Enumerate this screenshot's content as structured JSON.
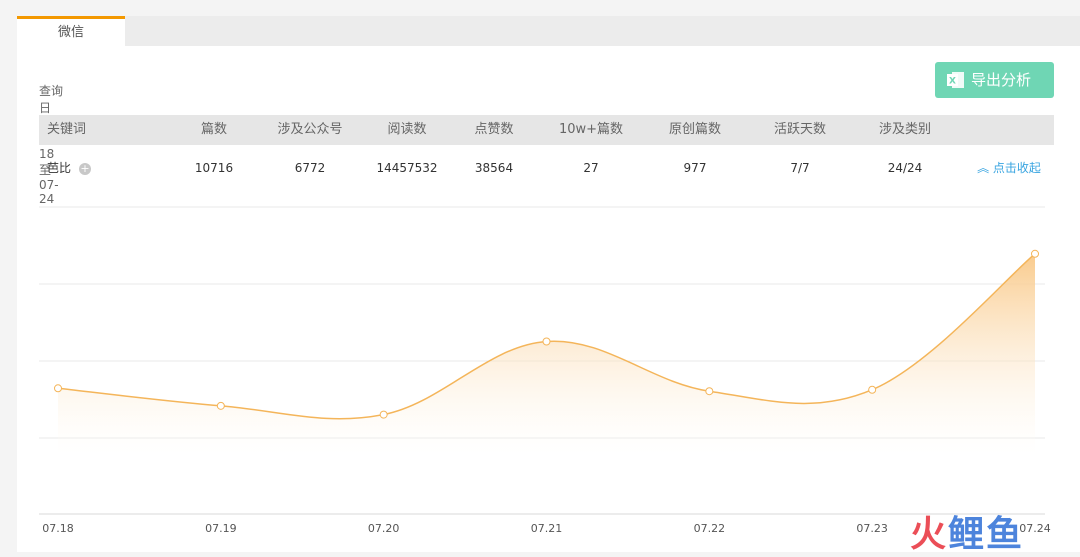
{
  "tab": {
    "label": "微信"
  },
  "query": {
    "text": "查询日期：07-18 至 07-24"
  },
  "export": {
    "label": "导出分析"
  },
  "table": {
    "headers": [
      "关键词",
      "篇数",
      "涉及公众号",
      "阅读数",
      "点赞数",
      "10w+篇数",
      "原创篇数",
      "活跃天数",
      "涉及类别"
    ],
    "row": {
      "keyword": "芭比",
      "cells": [
        "10716",
        "6772",
        "14457532",
        "38564",
        "27",
        "977",
        "7/7",
        "24/24"
      ],
      "collapse_label": "点击收起"
    }
  },
  "chart_data": {
    "type": "area",
    "categories": [
      "07.18",
      "07.19",
      "07.20",
      "07.21",
      "07.22",
      "07.23",
      "07.24"
    ],
    "values": [
      0.43,
      0.37,
      0.34,
      0.59,
      0.42,
      0.425,
      0.89
    ],
    "ylim": [
      0,
      1.05
    ],
    "grid": true,
    "colors": {
      "line": "#f4b55a",
      "fill_top": "#f9c886",
      "point_fill": "#ffffff"
    }
  },
  "watermark": {
    "text_a": "火",
    "text_b": "鲤鱼"
  }
}
